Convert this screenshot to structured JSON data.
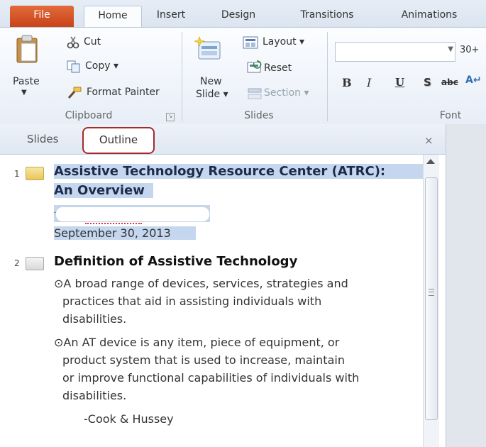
{
  "tabs": {
    "file": "File",
    "home": "Home",
    "insert": "Insert",
    "design": "Design",
    "transitions": "Transitions",
    "animations": "Animations"
  },
  "clipboard": {
    "paste": "Paste",
    "cut": "Cut",
    "copy": "Copy ▾",
    "format_painter": "Format Painter",
    "group_label": "Clipboard"
  },
  "slides": {
    "new_slide_line1": "New",
    "new_slide_line2": "Slide ▾",
    "layout": "Layout ▾",
    "reset": "Reset",
    "section": "Section ▾",
    "group_label": "Slides"
  },
  "font": {
    "size_value": "30+",
    "bold": "B",
    "italic": "I",
    "underline": "U",
    "shadow": "S",
    "strikethrough": "abc",
    "group_label": "Font"
  },
  "panel": {
    "tab_slides": "Slides",
    "tab_outline": "Outline",
    "close": "×"
  },
  "outline": {
    "slide1": {
      "number": "1",
      "title_line1": "Assistive Technology Resource Center (ATRC):",
      "title_line2": "An Overview",
      "dash": "-",
      "date": "September 30, 2013"
    },
    "slide2": {
      "number": "2",
      "title": "Definition  of Assistive Technology",
      "bullet1_line1": "⊙A broad range of devices, services, strategies and",
      "bullet1_line2": "practices that aid in assisting individuals  with",
      "bullet1_line3": "disabilities.",
      "bullet2_line1": "⊙An AT device is any item, piece of equipment, or",
      "bullet2_line2": "product system that is used to increase, maintain",
      "bullet2_line3": "or improve functional capabilities of individuals  with",
      "bullet2_line4": "disabilities.",
      "citation": "-Cook & Hussey"
    }
  },
  "colors": {
    "file_tab": "#d35a2a",
    "selection_highlight": "#c5d7ee",
    "outline_tab_border": "#a52a2a"
  }
}
